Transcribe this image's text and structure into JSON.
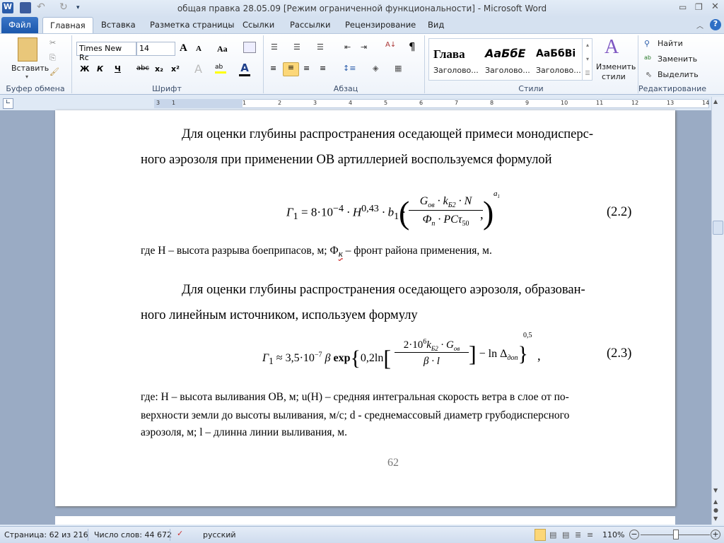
{
  "window": {
    "title": "общая правка 28.05.09 [Режим ограниченной функциональности]  -  Microsoft Word"
  },
  "tabs": [
    "Файл",
    "Главная",
    "Вставка",
    "Разметка страницы",
    "Ссылки",
    "Рассылки",
    "Рецензирование",
    "Вид"
  ],
  "ribbon": {
    "clipboard": {
      "paste": "Вставить",
      "label": "Буфер обмена"
    },
    "font": {
      "name": "Times New Rc",
      "size": "14",
      "label": "Шрифт",
      "bold": "Ж",
      "italic": "К",
      "underline": "Ч",
      "strike": "abc",
      "sub": "x₂",
      "sup": "x²",
      "grow": "A",
      "shrink": "A",
      "case": "Aa"
    },
    "paragraph": {
      "label": "Абзац",
      "pilcrow": "¶"
    },
    "styles": {
      "label": "Стили",
      "items": [
        {
          "preview": "Глава",
          "name": "Заголово..."
        },
        {
          "preview": "АаБбЕ",
          "name": "Заголово..."
        },
        {
          "preview": "АаБбВі",
          "name": "Заголово..."
        }
      ],
      "change_line1": "Изменить",
      "change_line2": "стили"
    },
    "editing": {
      "label": "Редактирование",
      "find": "Найти",
      "replace": "Заменить",
      "select": "Выделить"
    }
  },
  "ruler": {
    "numbers": [
      "3",
      "1",
      "1",
      "2",
      "3",
      "4",
      "5",
      "6",
      "7",
      "8",
      "9",
      "10",
      "11",
      "12",
      "13",
      "14",
      "15"
    ]
  },
  "document": {
    "p1_line1": "Для оценки глубины распространения оседающей примеси монодисперс-",
    "p1_line2": "ного аэрозоля при применении ОВ артиллерией воспользуемся формулой",
    "f1": {
      "lhs": "Г",
      "lhs_sub": "1",
      "eq": " = 8·10",
      "exp": "−4",
      "h": " · H",
      "hexp": "0,43",
      "b": " · b",
      "bsub": "1",
      "dot": " ·",
      "num": "G",
      "num_sub": "ов",
      "num2": " · k",
      "num2_sub": "Б2",
      "num3": " · N",
      "den": "Ф",
      "den_sub": "п",
      "den2": " · PCτ",
      "den2_sub": "50",
      "outer_exp": "a",
      "outer_exp_sub": "1",
      "comma": ",",
      "number": "(2.2)"
    },
    "p2": "где H – высота разрыва боеприпасов, м; Ф",
    "p2_sub": "к",
    "p2_rest": "– фронт района применения, м.",
    "p3_line1": "Для оценки глубины распространения оседающего аэрозоля, образован-",
    "p3_line2": "ного линейным источником, используем формулу",
    "f2": {
      "lhs": "Г",
      "lhs_sub": "1",
      "eq": " ≈ 3,5·10",
      "exp": "−7",
      "beta": " β ",
      "exp_fn": "exp",
      "inner": "0,2ln",
      "num": "2·10",
      "num_exp": "6",
      "num2": "k",
      "num2_sub": "Б2",
      "num3": " · G",
      "num3_sub": "ов",
      "den": "β · l",
      "minus": " − ln Δ",
      "delta_sub": "доп",
      "outer_exp": "0,5",
      "comma": ",",
      "number": "(2.3)"
    },
    "p4_line1": "где: H – высота выливания ОВ, м; u(H) – средняя интегральная скорость ветра в слое от по-",
    "p4_line2": "верхности земли до высоты выливания, м/с;  d  - среднемассовый диаметр грубодисперсного",
    "p4_line3": "аэрозоля, м; l – длинна линии выливания, м.",
    "page_number": "62"
  },
  "status": {
    "page": "Страница: 62 из 216",
    "words": "Число слов: 44 672",
    "lang": "русский",
    "zoom": "110%"
  }
}
